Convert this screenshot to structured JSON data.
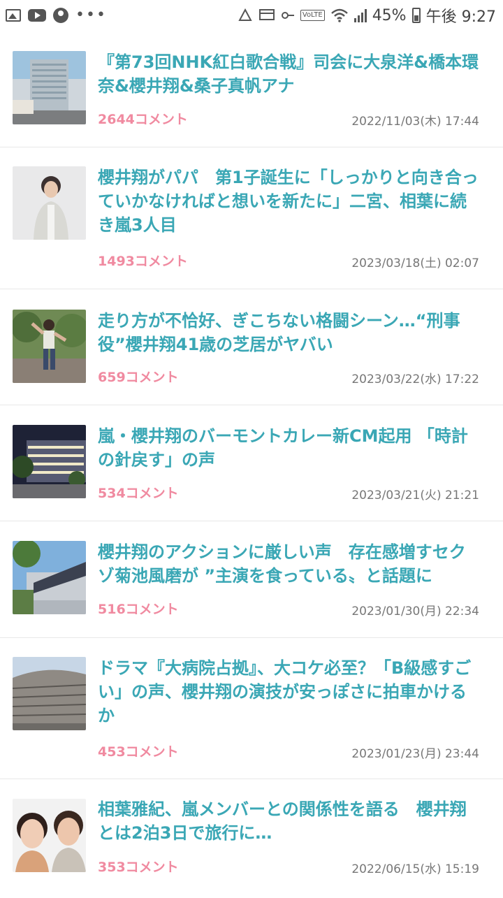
{
  "status_bar": {
    "battery": "45%",
    "time": "午後 9:27",
    "volte": "VoLTE",
    "icons_left": [
      "gallery-icon",
      "youtube-icon",
      "account-icon",
      "more-dots-icon"
    ],
    "icons_right": [
      "recycle-icon",
      "card-icon",
      "key-icon",
      "volte-icon",
      "wifi-icon",
      "signal-icon",
      "battery-icon"
    ]
  },
  "articles": [
    {
      "title": "『第73回NHK紅白歌合戦』司会に大泉洋&橋本環奈&櫻井翔&桑子真帆アナ",
      "comments": "2644コメント",
      "date": "2022/11/03(木) 17:44",
      "thumb": "building"
    },
    {
      "title": "櫻井翔がパパ　第1子誕生に「しっかりと向き合っていかなければと想いを新たに」二宮、相葉に続き嵐3人目",
      "comments": "1493コメント",
      "date": "2023/03/18(土) 02:07",
      "thumb": "person"
    },
    {
      "title": "走り方が不恰好、ぎこちない格闘シーン…“刑事役”櫻井翔41歳の芝居がヤバい",
      "comments": "659コメント",
      "date": "2023/03/22(水) 17:22",
      "thumb": "action"
    },
    {
      "title": "嵐・櫻井翔のバーモントカレー新CM起用 「時計の針戻す」の声",
      "comments": "534コメント",
      "date": "2023/03/21(火) 21:21",
      "thumb": "night-building"
    },
    {
      "title": "櫻井翔のアクションに厳しい声　存在感増すセクゾ菊池風磨が ”主演を食っている〟と話題に",
      "comments": "516コメント",
      "date": "2023/01/30(月) 22:34",
      "thumb": "office"
    },
    {
      "title": "ドラマ『大病院占拠』、大コケ必至？「B級感すごい」の声、櫻井翔の演技が安っぽさに拍車かけるか",
      "comments": "453コメント",
      "date": "2023/01/23(月) 23:44",
      "thumb": "round-building"
    },
    {
      "title": "相葉雅紀、嵐メンバーとの関係性を語る　櫻井翔とは2泊3日で旅行に…",
      "comments": "353コメント",
      "date": "2022/06/15(水) 15:19",
      "thumb": "two-people"
    }
  ],
  "colors": {
    "title": "#3aa7b5",
    "comments": "#f08aa0",
    "date": "#777777",
    "divider": "#e8e8e8"
  }
}
